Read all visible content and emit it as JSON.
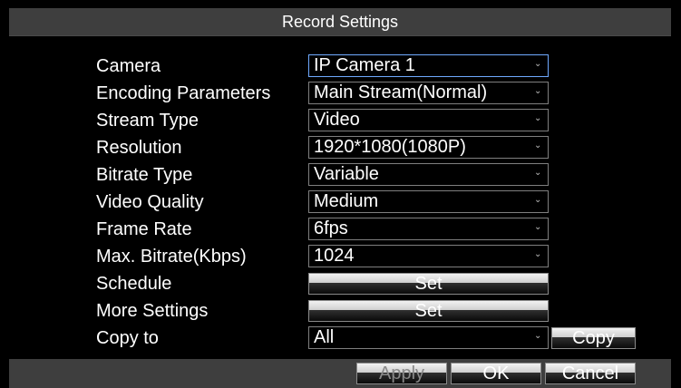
{
  "dialog": {
    "title": "Record Settings"
  },
  "fields": [
    {
      "label": "Camera",
      "value": "IP Camera 1",
      "arrow": "⌄"
    },
    {
      "label": "Encoding Parameters",
      "value": "Main Stream(Normal)",
      "arrow": "⌄"
    },
    {
      "label": "Stream Type",
      "value": "Video",
      "arrow": "⌄"
    },
    {
      "label": "Resolution",
      "value": "1920*1080(1080P)",
      "arrow": "⌄"
    },
    {
      "label": "Bitrate Type",
      "value": "Variable",
      "arrow": "⌄"
    },
    {
      "label": "Video Quality",
      "value": "Medium",
      "arrow": "⌄"
    },
    {
      "label": "Frame Rate",
      "value": "6fps",
      "arrow": "⌄"
    },
    {
      "label": "Max. Bitrate(Kbps)",
      "value": "1024",
      "arrow": "⌄"
    }
  ],
  "schedule": {
    "label": "Schedule",
    "button": "Set"
  },
  "more_settings": {
    "label": "More Settings",
    "button": "Set"
  },
  "copy_to": {
    "label": "Copy to",
    "value": "All",
    "arrow": "⌄",
    "button": "Copy"
  },
  "footer": {
    "apply": "Apply",
    "ok": "OK",
    "cancel": "Cancel"
  },
  "colors": {
    "background": "#000000",
    "title_bar": "#3e3e3e",
    "focus_border": "#6fa9ff",
    "disabled_text": "#8a8a8a"
  }
}
